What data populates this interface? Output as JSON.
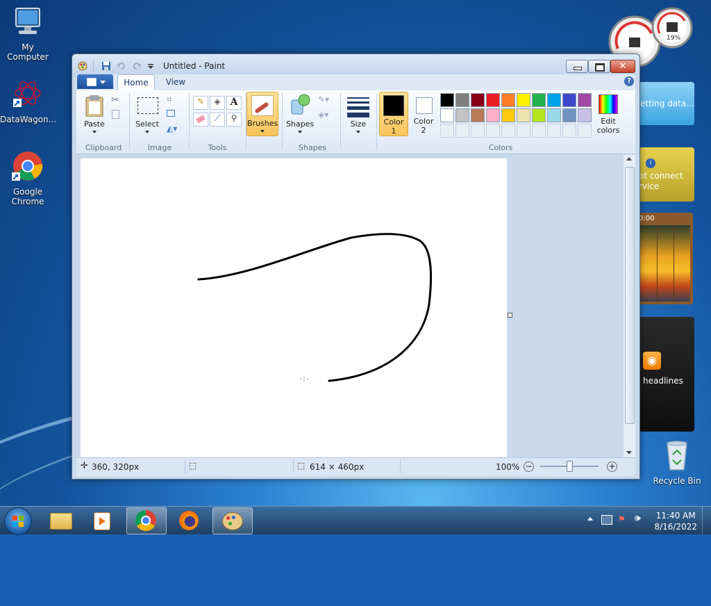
{
  "desktop": {
    "icons": [
      {
        "label": "My Computer"
      },
      {
        "label": "DataWagon..."
      },
      {
        "label": "Google Chrome"
      },
      {
        "label": "Recycle Bin"
      }
    ],
    "gadgets": {
      "meter_percent": "19%",
      "feed_text": "etting data...",
      "weather_text": "ot connect",
      "weather_text2": "rvice",
      "puzzle_time": "0:00",
      "headlines": "headlines"
    }
  },
  "paint": {
    "title": "Untitled - Paint",
    "tabs": [
      "Home",
      "View"
    ],
    "groups": {
      "clipboard": "Clipboard",
      "image": "Image",
      "tools": "Tools",
      "shapes": "Shapes",
      "colors": "Colors"
    },
    "buttons": {
      "paste": "Paste",
      "select": "Select",
      "brushes": "Brushes",
      "shapes": "Shapes",
      "size": "Size",
      "color1_line1": "Color",
      "color1_line2": "1",
      "color2_line1": "Color",
      "color2_line2": "2",
      "edit_colors_line1": "Edit",
      "edit_colors_line2": "colors"
    },
    "palette": [
      "#000000",
      "#7f7f7f",
      "#880015",
      "#ed1c24",
      "#ff7f27",
      "#fff200",
      "#22b14c",
      "#00a2e8",
      "#3f48cc",
      "#a349a4",
      "#ffffff",
      "#c3c3c3",
      "#b97a57",
      "#ffaec9",
      "#ffc90e",
      "#efe4b0",
      "#b5e61d",
      "#99d9ea",
      "#7092be",
      "#c8bfe7"
    ],
    "color1": "#000000",
    "color2": "#ffffff",
    "status": {
      "cursor_pos": "360, 320px",
      "canvas_size": "614 × 460px",
      "zoom": "100%"
    }
  },
  "taskbar": {
    "time": "11:40 AM",
    "date": "8/16/2022"
  }
}
